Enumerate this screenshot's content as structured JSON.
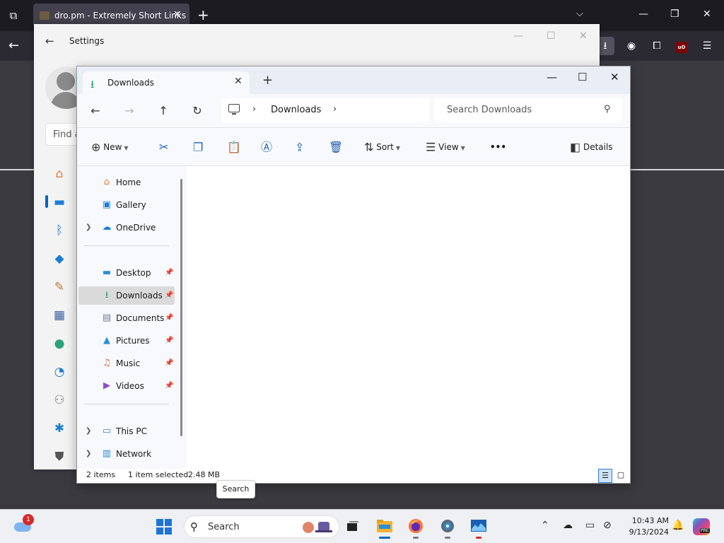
{
  "browser": {
    "tab_title": "dro.pm - Extremely Short Links",
    "tab_close": "✕",
    "new_tab": "+",
    "minimize": "—",
    "restore": "❐",
    "close": "✕"
  },
  "settings": {
    "title": "Settings",
    "search_placeholder": "Find a setting",
    "nav_icons": [
      "home-icon",
      "system-icon",
      "bluetooth-icon",
      "network-icon",
      "personalization-icon",
      "apps-icon",
      "accounts-icon",
      "time-language-icon",
      "gaming-icon",
      "accessibility-icon",
      "privacy-icon"
    ]
  },
  "explorer": {
    "tab_title": "Downloads",
    "tab_close": "✕",
    "new_tab": "+",
    "minimize": "—",
    "maximize": "☐",
    "close": "✕",
    "breadcrumb": {
      "location": "Downloads",
      "separator": "›"
    },
    "search_placeholder": "Search Downloads",
    "commands": {
      "new": "New",
      "sort": "Sort",
      "view": "View",
      "more": "•••",
      "details": "Details"
    },
    "sidebar": {
      "top": [
        {
          "label": "Home",
          "icon": "home-icon"
        },
        {
          "label": "Gallery",
          "icon": "gallery-icon"
        },
        {
          "label": "OneDrive",
          "icon": "onedrive-icon",
          "expandable": true
        }
      ],
      "quick_access": [
        {
          "label": "Desktop",
          "icon": "desktop-icon",
          "pinned": true
        },
        {
          "label": "Downloads",
          "icon": "downloads-icon",
          "pinned": true,
          "selected": true
        },
        {
          "label": "Documents",
          "icon": "documents-icon",
          "pinned": true
        },
        {
          "label": "Pictures",
          "icon": "pictures-icon",
          "pinned": true
        },
        {
          "label": "Music",
          "icon": "music-icon",
          "pinned": true
        },
        {
          "label": "Videos",
          "icon": "videos-icon",
          "pinned": true
        }
      ],
      "bottom": [
        {
          "label": "This PC",
          "icon": "this-pc-icon",
          "expandable": true
        },
        {
          "label": "Network",
          "icon": "network-icon",
          "expandable": true
        }
      ]
    },
    "status": {
      "item_count": "2 items",
      "selection": "1 item selected",
      "size": "2.48 MB"
    }
  },
  "tooltip": "Search",
  "taskbar": {
    "weather_badge": "1",
    "search_label": "Search",
    "clock_time": "10:43 AM",
    "clock_date": "9/13/2024",
    "copilot_badge": "PRE"
  },
  "colors": {
    "accent": "#0067c0",
    "download_green": "#1e9e6c",
    "browser_dark": "#1c1b22"
  }
}
